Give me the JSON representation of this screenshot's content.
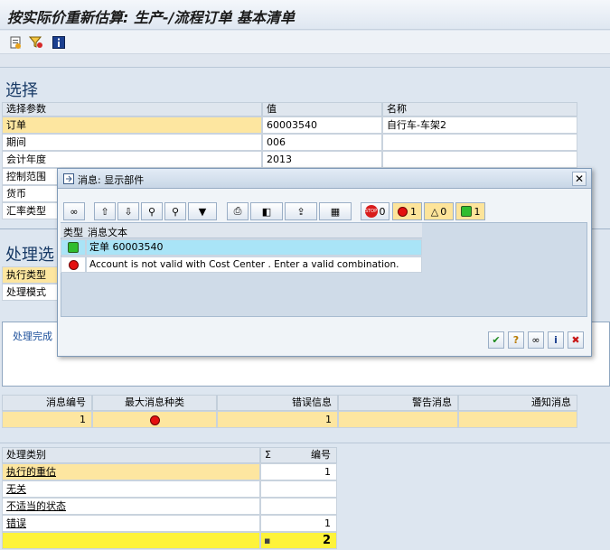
{
  "window": {
    "title": "按实际价重新估算: 生产-/流程订单 基本清单"
  },
  "toolbar": {
    "icons": [
      "refresh-doc-icon",
      "filter-icon",
      "info-icon"
    ]
  },
  "selection": {
    "section_title": "选择",
    "columns": [
      "选择参数",
      "值",
      "名称"
    ],
    "rows": [
      {
        "param": "订单",
        "value": "60003540",
        "name": "自行车-车架2"
      },
      {
        "param": "期间",
        "value": "006",
        "name": ""
      },
      {
        "param": "会计年度",
        "value": "2013",
        "name": ""
      },
      {
        "param": "控制范围",
        "value": "",
        "name": ""
      },
      {
        "param": "货币",
        "value": "",
        "name": ""
      },
      {
        "param": "汇率类型",
        "value": "",
        "name": ""
      }
    ]
  },
  "processing": {
    "section_title": "处理选",
    "rows": [
      {
        "label": "执行类型"
      },
      {
        "label": "处理模式"
      }
    ],
    "status_text": "处理完成"
  },
  "dialog": {
    "title": "消息: 显示部件",
    "counters": {
      "stop": "0",
      "error": "1",
      "warning": "0",
      "success": "1"
    },
    "columns": [
      "类型",
      "消息文本"
    ],
    "messages": [
      {
        "type": "success",
        "text": "定单 60003540"
      },
      {
        "type": "error",
        "text": "Account  is not valid with Cost Center .  Enter a valid combination."
      }
    ],
    "footer_icons": [
      "check-icon",
      "help-icon",
      "glasses-icon",
      "info-icon",
      "cancel-icon"
    ]
  },
  "summary": {
    "columns": [
      "消息编号",
      "最大消息种类",
      "错误信息",
      "警告消息",
      "通知消息"
    ],
    "row": {
      "msg_no": "1",
      "max_type": "error",
      "errors": "1",
      "warnings": "",
      "notices": ""
    }
  },
  "categories": {
    "columns": [
      "处理类别",
      "Σ",
      "编号"
    ],
    "rows": [
      {
        "label": "执行的重估",
        "count": "1"
      },
      {
        "label": "无关",
        "count": ""
      },
      {
        "label": "不适当的状态",
        "count": ""
      },
      {
        "label": "错误",
        "count": "1"
      }
    ],
    "total_marker": "▪",
    "total": "2"
  }
}
